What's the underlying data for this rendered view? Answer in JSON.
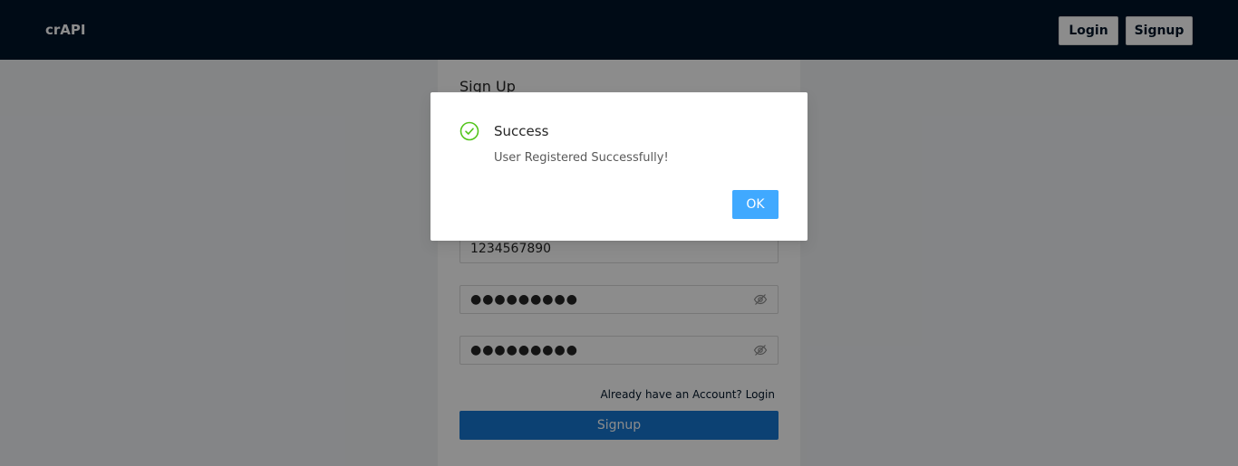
{
  "navbar": {
    "brand": "crAPI",
    "login_label": "Login",
    "signup_label": "Signup"
  },
  "signup_form": {
    "title": "Sign Up",
    "phone_value": "1234567890",
    "password_value": "●●●●●●●●●",
    "confirm_password_value": "●●●●●●●●●",
    "login_link": "Already have an Account? Login",
    "submit_label": "Signup"
  },
  "modal": {
    "title": "Success",
    "message": "User Registered Successfully!",
    "ok_label": "OK",
    "icon": "check-circle-icon"
  },
  "colors": {
    "navbar_bg": "#001529",
    "primary": "#1677d2",
    "ok_button": "#40a9ff",
    "success": "#52c41a"
  }
}
